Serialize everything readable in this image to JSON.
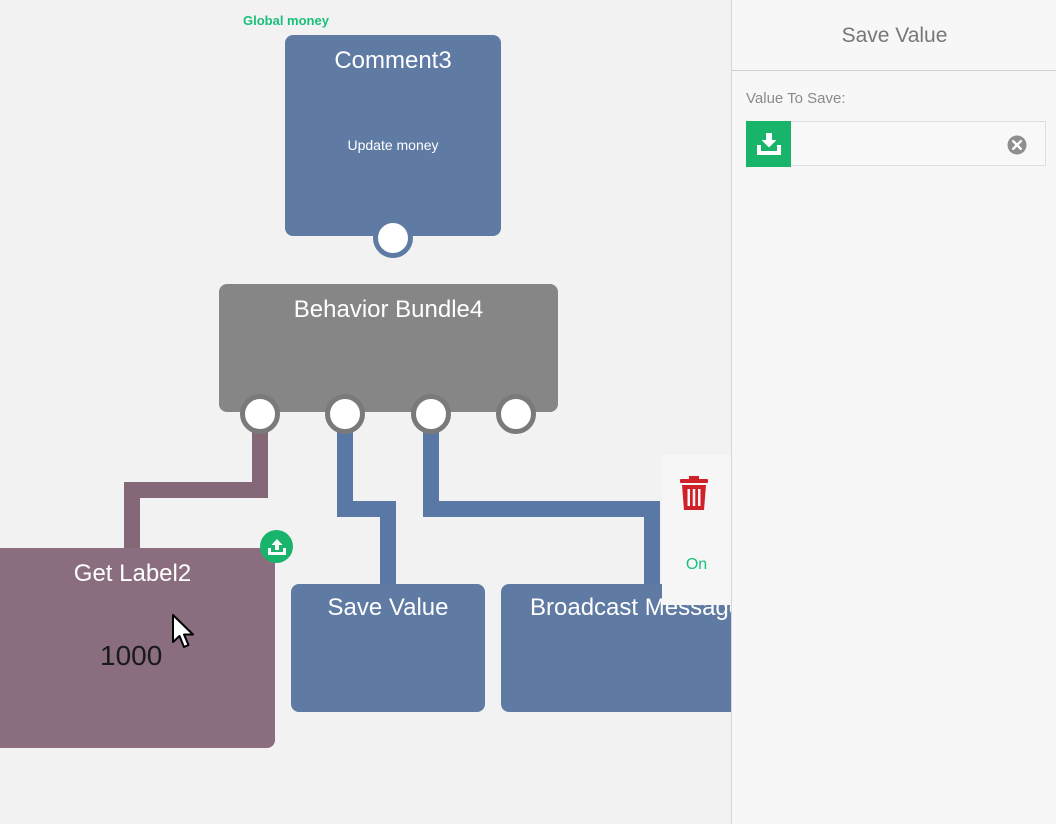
{
  "canvas": {
    "comment_label": "Global money",
    "nodes": {
      "comment": {
        "title": "Comment3",
        "subtitle": "Update money"
      },
      "bundle": {
        "title": "Behavior Bundle4"
      },
      "get_label": {
        "title": "Get Label2",
        "value": "1000"
      },
      "save_value": {
        "title": "Save Value"
      },
      "broadcast": {
        "title": "Broadcast Message"
      }
    },
    "context_menu": {
      "on_label": "On"
    }
  },
  "panel": {
    "title": "Save Value",
    "field_label": "Value To Save:",
    "field_value": "",
    "field_placeholder": ""
  },
  "colors": {
    "accent_green": "#18b46b",
    "node_blue": "#5f7aa3",
    "node_gray": "#868686",
    "node_mauve": "#8a6e80",
    "trash_red": "#d0202a"
  },
  "icons": {
    "export": "upload-tray-icon",
    "field": "download-tray-icon",
    "delete": "trash-icon",
    "clear": "clear-circle-icon"
  }
}
